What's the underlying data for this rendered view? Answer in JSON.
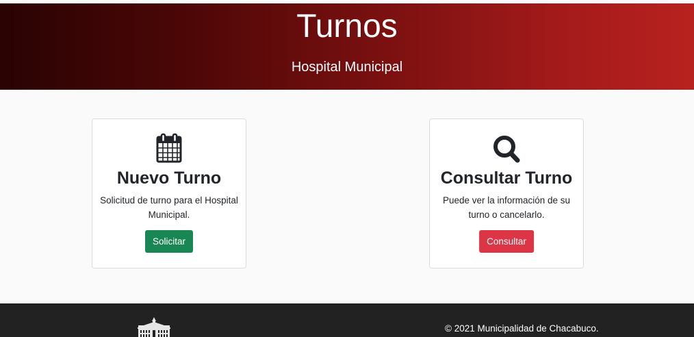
{
  "hero": {
    "title": "Turnos",
    "subtitle": "Hospital Municipal"
  },
  "cards": [
    {
      "icon": "calendar-icon",
      "title": "Nuevo Turno",
      "text": "Solicitud de turno para el Hospital Municipal.",
      "button_label": "Solicitar",
      "button_color": "#198754"
    },
    {
      "icon": "search-icon",
      "title": "Consultar Turno",
      "text": "Puede ver la información de su turno o cancelarlo.",
      "button_label": "Consultar",
      "button_color": "#dc3545"
    }
  ],
  "footer": {
    "logo_icon": "municipal-building-logo",
    "copyright": "© 2021 Municipalidad de Chacabuco."
  },
  "colors": {
    "hero_gradient_start": "#2a0303",
    "hero_gradient_end": "#b8221f",
    "footer_background": "#222222"
  }
}
